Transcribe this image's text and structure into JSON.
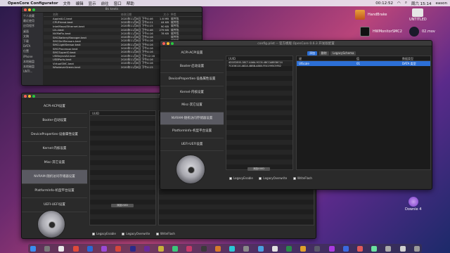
{
  "menubar": {
    "apple": "",
    "app": "OpenCore Configurator",
    "menus": [
      "文件",
      "编辑",
      "显示",
      "前往",
      "窗口",
      "帮助"
    ],
    "clock": "周六 15:14",
    "user": "eason",
    "battery": "00:12:52"
  },
  "finder": {
    "title": "8k kexts",
    "sidebar": [
      "个人收藏",
      "最近使用",
      "应用程序",
      "桌面",
      "文稿",
      "下载",
      "DATA",
      "位置",
      "iPhone",
      "本地磁盘",
      "本地磁盘",
      "UNTI..."
    ],
    "headers": [
      "名称",
      "修改日期",
      "大小",
      "种类"
    ],
    "rows": [
      {
        "name": "AppleALC.kext",
        "date": "2020年11月8日 下午4:46",
        "size": "1.8 MB",
        "kind": "软件包"
      },
      {
        "name": "CPUFriend.kext",
        "date": "2020年11月8日 下午4:11",
        "size": "44 KB",
        "kind": "软件包"
      },
      {
        "name": "IntelMausiEthernet.kext",
        "date": "2020年11月8日 下午4:15",
        "size": "90 KB",
        "kind": "软件包"
      },
      {
        "name": "Lilu.kext",
        "date": "2020年11月8日 下午4:46",
        "size": "279 KB",
        "kind": "软件包"
      },
      {
        "name": "NVMeFix.kext",
        "date": "2020年11月8日 下午4:16",
        "size": "78 KB",
        "kind": "软件包"
      },
      {
        "name": "SMCBatteryManager.kext",
        "date": "2020年11月8日 下午4:16",
        "size": "",
        "kind": "软件包"
      },
      {
        "name": "SMCDellSensors.kext",
        "date": "2020年11月8日 下午4:16",
        "size": "",
        "kind": "软件包"
      },
      {
        "name": "SMCLightSensor.kext",
        "date": "2020年11月8日 下午4:16",
        "size": "",
        "kind": "软件包"
      },
      {
        "name": "SMCProcessor.kext",
        "date": "2020年11月8日 下午4:16",
        "size": "",
        "kind": "软件包"
      },
      {
        "name": "SMCSuperIO.kext",
        "date": "2020年11月8日 下午4:16",
        "size": "",
        "kind": "软件包"
      },
      {
        "name": "USBInjectAll.kext",
        "date": "2020年11月8日 下午12:16",
        "size": "",
        "kind": "软件包"
      },
      {
        "name": "USBPorts.kext",
        "date": "2020年11月8日 下午4:16",
        "size": "",
        "kind": "软件包"
      },
      {
        "name": "VirtualSMC.kext",
        "date": "2020年11月8日 下午4:16",
        "size": "",
        "kind": "软件包"
      },
      {
        "name": "WhateverGreen.kext",
        "date": "2020年11月8日 下午4:15",
        "size": "",
        "kind": "软件包"
      }
    ]
  },
  "nav_items": [
    "ACPI-ACPI设置",
    "Booter-启动设置",
    "DeviceProperties-设备属性设置",
    "Kernel-内核设置",
    "Misc-其它设置",
    "NVRAM-随机访问存储器设置",
    "PlatformInfo-机型平台设置",
    "UEFI-UEFI设置"
  ],
  "oc_back": {
    "title": "",
    "panel_header": "UUID",
    "add_button": "添加UUID",
    "checks": [
      "LegacyEnable",
      "LegacyOverwrite",
      "WriteFlash"
    ],
    "behind_title": "Sample.plist"
  },
  "oc_front": {
    "title": "config.plist -- 官方模版 OpenCore 0.6.3 开发版配置",
    "uuid_header": "UUID",
    "uuids": [
      "4D1EDE05-38C7-4A6A-9CC6-4BCCA8B38C14",
      "7C436110-AB2A-4BBB-A880-FE41995C9F82"
    ],
    "add_button": "添加UUID",
    "tabs": [
      "添加",
      "删除",
      "LegacySchema"
    ],
    "table_headers": [
      "键",
      "值",
      "数据类型"
    ],
    "selected_row": {
      "key": "UIScale",
      "value": "01",
      "type": "DATA 类型"
    },
    "checks": [
      "LegacyEnable",
      "LegacyOverwrite",
      "WriteFlash"
    ]
  },
  "desktop": {
    "icons": [
      {
        "label": "HandBrake"
      },
      {
        "label": "UNTITLED"
      },
      {
        "label": "HWMonitorSMC2"
      },
      {
        "label": "02.mov"
      },
      {
        "label": "Downie 4"
      }
    ],
    "colors": {
      "accent": "#2c6fd6",
      "window": "#2a2a2a",
      "selected": "#5a5a62"
    }
  }
}
